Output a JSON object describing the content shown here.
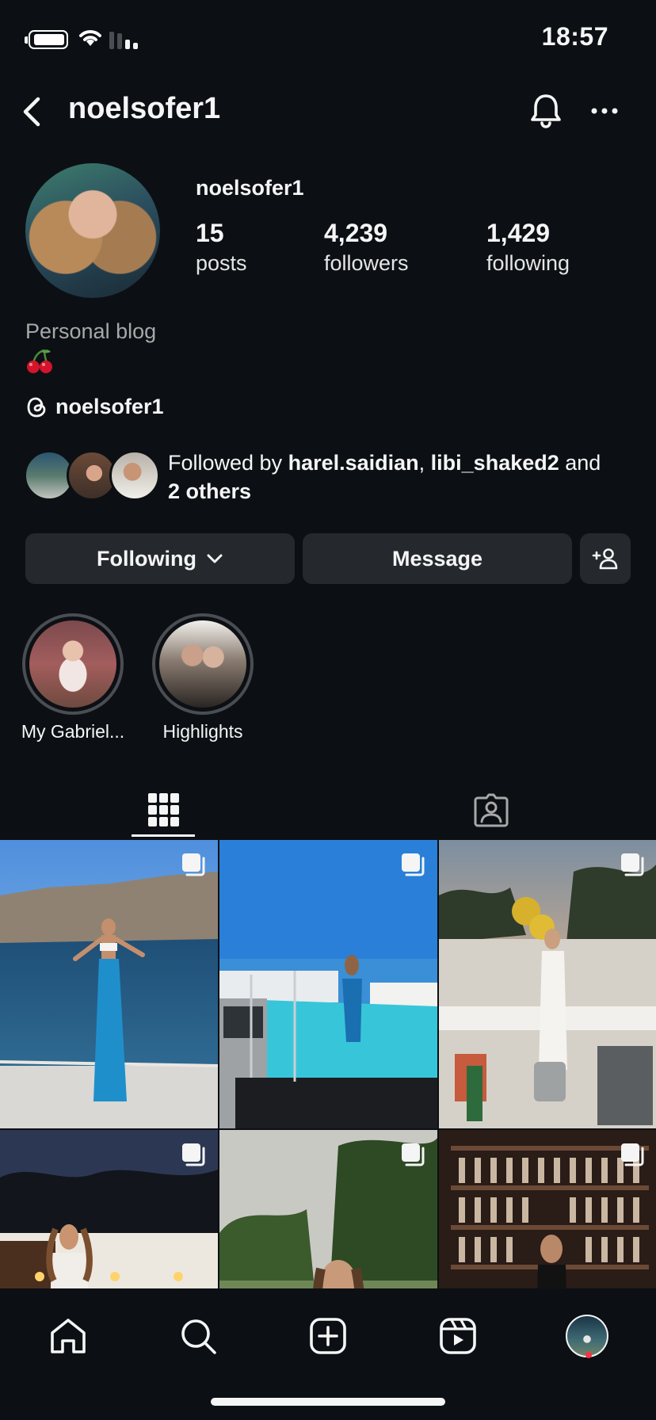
{
  "status_bar": {
    "time": "18:57"
  },
  "header": {
    "username": "noelsofer1"
  },
  "profile": {
    "display_name": "noelsofer1",
    "stats": [
      {
        "value": "15",
        "label": "posts"
      },
      {
        "value": "4,239",
        "label": "followers"
      },
      {
        "value": "1,429",
        "label": "following"
      }
    ],
    "category": "Personal blog",
    "bio_emoji": "🍒",
    "threads_handle": "noelsofer1"
  },
  "followed_by": {
    "prefix": "Followed by ",
    "user1": "harel.saidian",
    "separator": ", ",
    "user2": "libi_shaked2",
    "conjunction": " and",
    "others": "2 others"
  },
  "actions": {
    "following_label": "Following",
    "message_label": "Message"
  },
  "highlights": [
    {
      "label": "My Gabriel..."
    },
    {
      "label": "Highlights"
    }
  ],
  "tabs": [
    "posts-grid",
    "tagged"
  ],
  "colors": {
    "background": "#0c1014",
    "button": "#25292e",
    "secondary_text": "#a8a8a8",
    "notification_dot": "#ff3040"
  },
  "bottom_nav": [
    "home-icon",
    "search-icon",
    "create-icon",
    "reels-icon",
    "profile-avatar"
  ]
}
